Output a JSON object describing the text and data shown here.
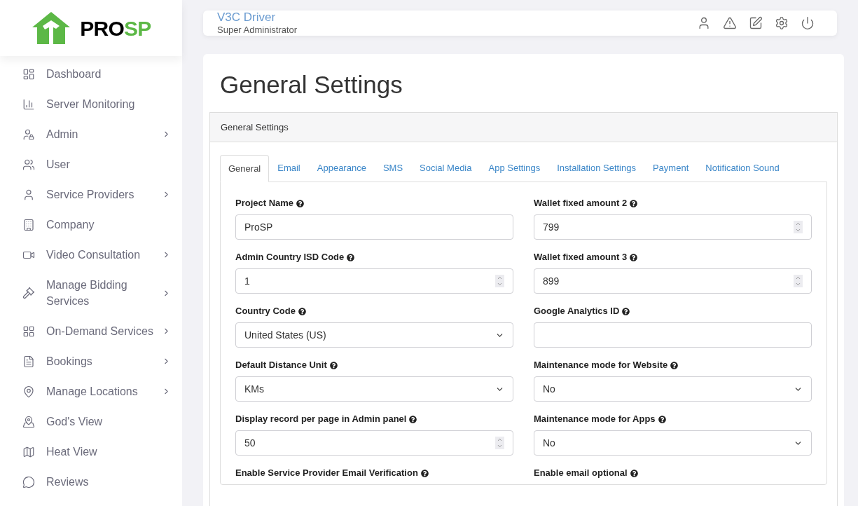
{
  "logo": {
    "text_dark": "PRO",
    "text_accent": "SP"
  },
  "sidebar": {
    "items": [
      {
        "label": "Dashboard",
        "has_submenu": false
      },
      {
        "label": "Server Monitoring",
        "has_submenu": false
      },
      {
        "label": "Admin",
        "has_submenu": true
      },
      {
        "label": "User",
        "has_submenu": false
      },
      {
        "label": "Service Providers",
        "has_submenu": true
      },
      {
        "label": "Company",
        "has_submenu": false
      },
      {
        "label": "Video Consultation",
        "has_submenu": true
      },
      {
        "label": "Manage Bidding Services",
        "has_submenu": true
      },
      {
        "label": "On-Demand Services",
        "has_submenu": true
      },
      {
        "label": "Bookings",
        "has_submenu": true
      },
      {
        "label": "Manage Locations",
        "has_submenu": true
      },
      {
        "label": "God's View",
        "has_submenu": false
      },
      {
        "label": "Heat View",
        "has_submenu": false
      },
      {
        "label": "Reviews",
        "has_submenu": false
      }
    ]
  },
  "header": {
    "user_name": "V3C Driver",
    "role": "Super Administrator"
  },
  "page_title": "General Settings",
  "panel": {
    "title": "General Settings",
    "tabs": [
      {
        "label": "General",
        "selected": true
      },
      {
        "label": "Email",
        "selected": false
      },
      {
        "label": "Appearance",
        "selected": false
      },
      {
        "label": "SMS",
        "selected": false
      },
      {
        "label": "Social Media",
        "selected": false
      },
      {
        "label": "App Settings",
        "selected": false
      },
      {
        "label": "Installation Settings",
        "selected": false
      },
      {
        "label": "Payment",
        "selected": false
      },
      {
        "label": "Notification Sound",
        "selected": false
      }
    ],
    "columns": [
      [
        {
          "label": "Project Name",
          "kind": "text",
          "value": "ProSP"
        },
        {
          "label": "Admin Country ISD Code",
          "kind": "number",
          "value": "1"
        },
        {
          "label": "Country Code",
          "kind": "select",
          "value": "United States (US)"
        },
        {
          "label": "Default Distance Unit",
          "kind": "select",
          "value": "KMs"
        },
        {
          "label": "Display record per page in Admin panel",
          "kind": "number",
          "value": "50"
        },
        {
          "label": "Enable Service Provider Email Verification",
          "kind": "label"
        }
      ],
      [
        {
          "label": "Wallet fixed amount 2",
          "kind": "number",
          "value": "799"
        },
        {
          "label": "Wallet fixed amount 3",
          "kind": "number",
          "value": "899"
        },
        {
          "label": "Google Analytics ID",
          "kind": "text"
        },
        {
          "label": "Maintenance mode for Website",
          "kind": "select",
          "value": "No"
        },
        {
          "label": "Maintenance mode for Apps",
          "kind": "select",
          "value": "No"
        },
        {
          "label": "Enable email optional",
          "kind": "label"
        }
      ]
    ]
  }
}
